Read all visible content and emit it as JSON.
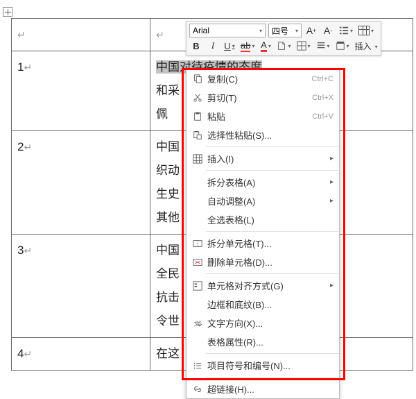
{
  "toolbar": {
    "font": "Arial",
    "size": "四号",
    "bigger": "A",
    "smaller": "A",
    "bold": "B",
    "italic": "I",
    "underline": "U",
    "strike": "ab",
    "fontcolor": "A",
    "insert_label": "插入"
  },
  "table": {
    "rows": [
      {
        "num": "1",
        "lines": [
          "中国对待疫情的态度",
          "和采",
          "佩"
        ]
      },
      {
        "num": "2",
        "lines": [
          "中国",
          "织动",
          "生史",
          "其他"
        ]
      },
      {
        "num": "3",
        "lines": [
          "中国",
          "全民",
          "抗击",
          "令世"
        ]
      },
      {
        "num": "4",
        "lines": [
          "在这"
        ]
      }
    ]
  },
  "menu": {
    "items": [
      {
        "icon": "copy-icon",
        "label": "复制(C)",
        "shortcut": "Ctrl+C"
      },
      {
        "icon": "cut-icon",
        "label": "剪切(T)",
        "shortcut": "Ctrl+X"
      },
      {
        "icon": "paste-icon",
        "label": "粘贴",
        "shortcut": "Ctrl+V"
      },
      {
        "icon": "paste-special-icon",
        "label": "选择性粘贴(S)...",
        "sep_after": true
      },
      {
        "icon": "insert-icon",
        "label": "插入(I)",
        "submenu": true,
        "sep_after": true
      },
      {
        "icon": "",
        "label": "拆分表格(A)",
        "submenu": true
      },
      {
        "icon": "",
        "label": "自动调整(A)",
        "submenu": true
      },
      {
        "icon": "",
        "label": "全选表格(L)",
        "sep_after": true
      },
      {
        "icon": "split-cell-icon",
        "label": "拆分单元格(T)..."
      },
      {
        "icon": "delete-cell-icon",
        "label": "删除单元格(D)...",
        "sep_after": true
      },
      {
        "icon": "align-icon",
        "label": "单元格对齐方式(G)",
        "submenu": true
      },
      {
        "icon": "",
        "label": "边框和底纹(B)..."
      },
      {
        "icon": "text-direction-icon",
        "label": "文字方向(X)..."
      },
      {
        "icon": "",
        "label": "表格属性(R)...",
        "sep_after": true
      },
      {
        "icon": "list-icon",
        "label": "项目符号和编号(N)...",
        "sep_after": true
      },
      {
        "icon": "link-icon",
        "label": "超链接(H)..."
      }
    ]
  }
}
